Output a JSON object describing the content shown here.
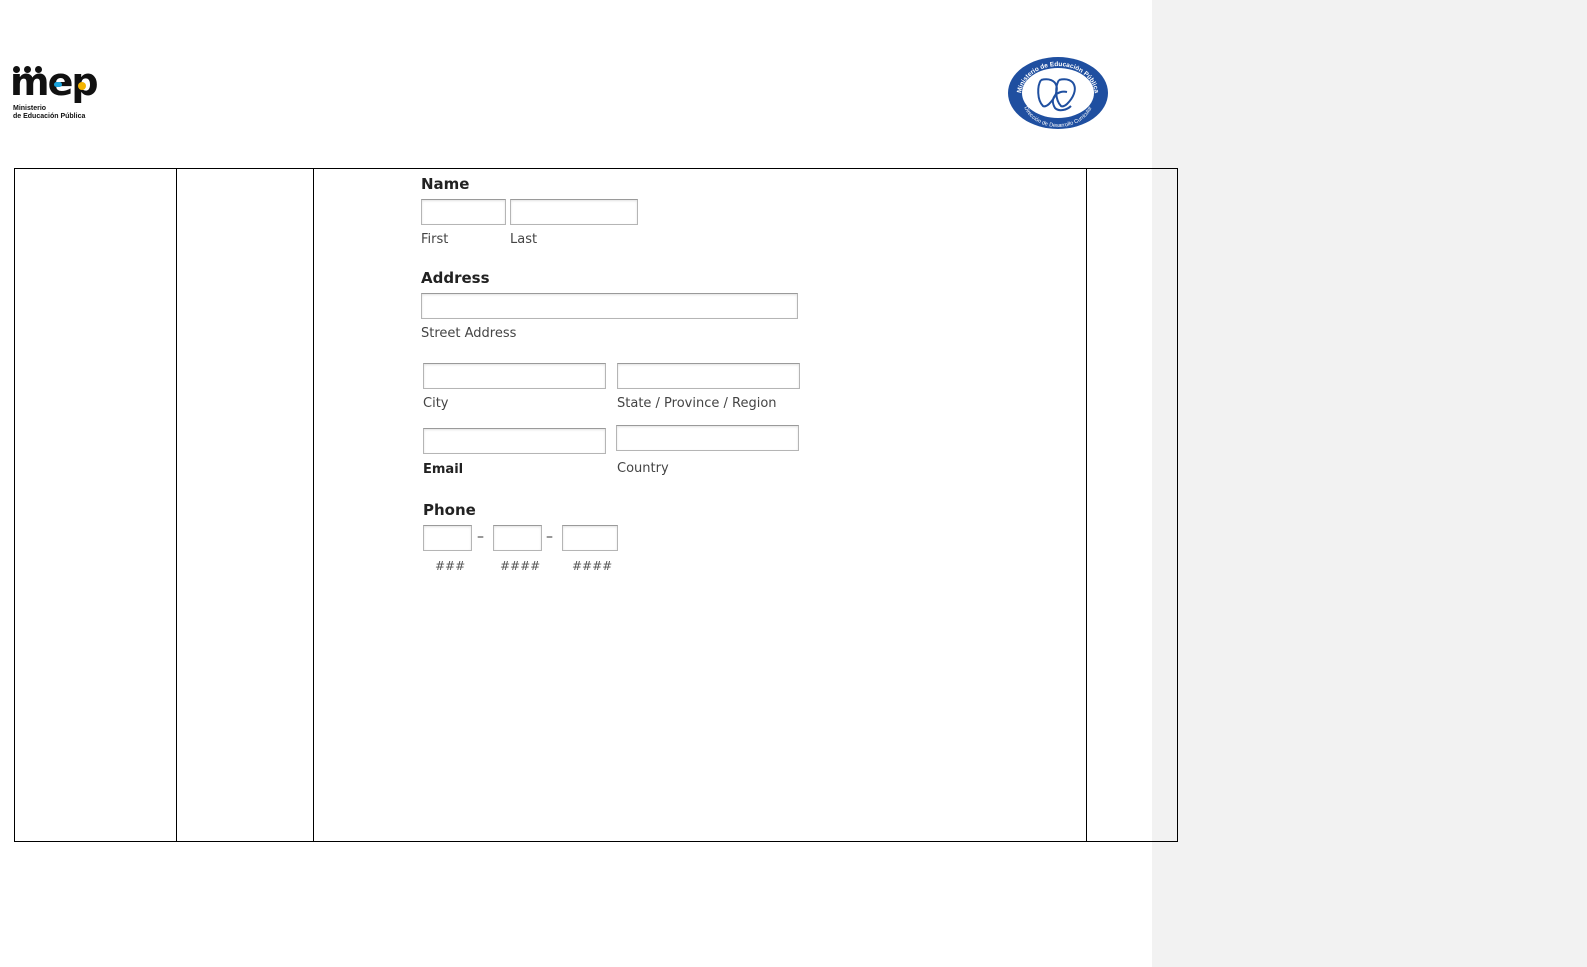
{
  "header": {
    "mep_logo": {
      "wordmark": "mep",
      "line1": "Ministerio",
      "line2": "de Educación Pública"
    },
    "seal": {
      "outer_text": "Ministerio de Educación Pública",
      "inner_text": "Dirección de Desarrollo Curricular",
      "monogram": "DDC"
    }
  },
  "form": {
    "name": {
      "heading": "Name",
      "first_label": "First",
      "last_label": "Last"
    },
    "address": {
      "heading": "Address",
      "street_label": "Street Address",
      "city_label": "City",
      "state_label": "State / Province / Region",
      "email_label": "Email",
      "country_label": "Country"
    },
    "phone": {
      "heading": "Phone",
      "separator": "–",
      "part1_hint": "###",
      "part2_hint": "####",
      "part3_hint": "####"
    }
  },
  "colors": {
    "mep_blue": "#1aa3dc",
    "mep_yellow": "#f4b400",
    "seal_blue": "#1f4fa0"
  }
}
